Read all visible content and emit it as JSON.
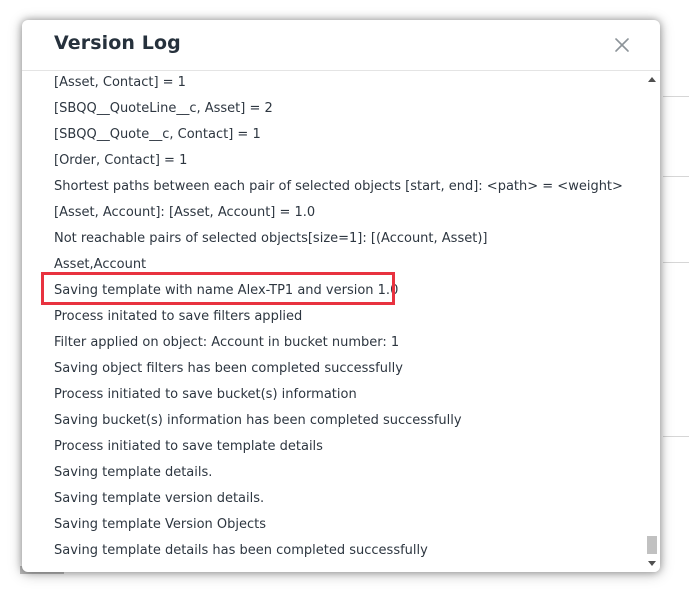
{
  "dialog": {
    "title": "Version Log",
    "close_icon": "close-icon"
  },
  "log": {
    "entries": [
      "[Asset, Contact] = 1",
      "[SBQQ__QuoteLine__c, Asset] = 2",
      "[SBQQ__Quote__c, Contact] = 1",
      "[Order, Contact] = 1",
      "Shortest paths between each pair of selected objects [start, end]: <path> = <weight>",
      "[Asset, Account]: [Asset, Account] = 1.0",
      "Not reachable pairs of selected objects[size=1]: [(Account, Asset)]",
      "Asset,Account",
      "Saving template with name Alex-TP1 and version 1.0",
      "Process initated to save filters applied",
      "Filter applied on object: Account in bucket number: 1",
      "Saving object filters has been completed successfully",
      "Process initiated to save bucket(s) information",
      "Saving bucket(s) information has been completed successfully",
      "Process initiated to save template details",
      "Saving template details.",
      "Saving template version details.",
      "Saving template Version Objects",
      "Saving template details has been completed successfully"
    ],
    "highlighted_entry_index": 8
  },
  "colors": {
    "highlight": "#e8323f",
    "title": "#26313c",
    "text": "#2d3640"
  }
}
